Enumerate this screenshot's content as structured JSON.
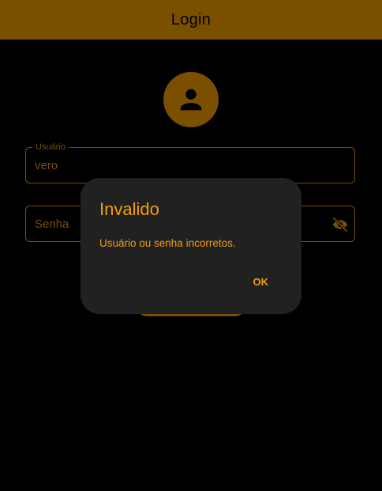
{
  "appbar": {
    "title": "Login"
  },
  "form": {
    "username": {
      "label": "Usuário",
      "value": "vero"
    },
    "password": {
      "label": "Senha",
      "value": ""
    }
  },
  "dialog": {
    "title": "Invalido",
    "message": "Usuário ou senha incorretos.",
    "ok_label": "OK"
  },
  "icons": {
    "avatar": "person-icon",
    "password_toggle": "visibility-off-icon"
  },
  "colors": {
    "primary": "#7a4f00",
    "dialog_text": "#f39c12",
    "dialog_bg": "#212121",
    "background": "#000000"
  }
}
